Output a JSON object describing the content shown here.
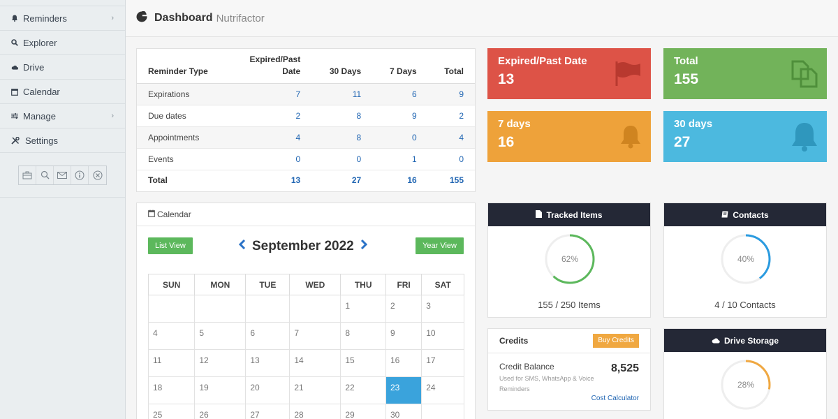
{
  "sidebar": {
    "items": [
      {
        "label": "Reminders",
        "icon": "bell-icon",
        "chevron": "›"
      },
      {
        "label": "Explorer",
        "icon": "search-icon"
      },
      {
        "label": "Drive",
        "icon": "cloud-icon"
      },
      {
        "label": "Calendar",
        "icon": "calendar-icon"
      },
      {
        "label": "Manage",
        "icon": "sliders-icon",
        "chevron": "›"
      },
      {
        "label": "Settings",
        "icon": "tools-icon"
      }
    ],
    "tools": [
      "briefcase-icon",
      "search-icon",
      "mail-icon",
      "info-icon",
      "close-circle-icon"
    ]
  },
  "header": {
    "title": "Dashboard",
    "subtitle": "Nutrifactor",
    "icon": "pie-chart-icon"
  },
  "reminder_table": {
    "headers": {
      "type": "Reminder Type",
      "expired_line1": "Expired/Past",
      "expired_line2": "Date",
      "d30": "30 Days",
      "d7": "7 Days",
      "total": "Total"
    },
    "rows": [
      {
        "type": "Expirations",
        "expired": "7",
        "d30": "11",
        "d7": "6",
        "total": "9"
      },
      {
        "type": "Due dates",
        "expired": "2",
        "d30": "8",
        "d7": "9",
        "total": "2"
      },
      {
        "type": "Appointments",
        "expired": "4",
        "d30": "8",
        "d7": "0",
        "total": "4"
      },
      {
        "type": "Events",
        "expired": "0",
        "d30": "0",
        "d7": "1",
        "total": "0"
      },
      {
        "type": "Total",
        "expired": "13",
        "d30": "27",
        "d7": "16",
        "total": "155"
      }
    ]
  },
  "cards": [
    {
      "label": "Expired/Past Date",
      "value": "13",
      "color": "#dd5347",
      "icon": "flag-icon"
    },
    {
      "label": "Total",
      "value": "155",
      "color": "#72b35a",
      "icon": "copy-icon"
    },
    {
      "label": "7 days",
      "value": "16",
      "color": "#eea23a",
      "icon": "bell-icon"
    },
    {
      "label": "30 days",
      "value": "27",
      "color": "#4cb9df",
      "icon": "bell-icon"
    }
  ],
  "calendar": {
    "heading": "Calendar",
    "list_view": "List View",
    "year_view": "Year View",
    "month": "September 2022",
    "days": [
      "SUN",
      "MON",
      "TUE",
      "WED",
      "THU",
      "FRI",
      "SAT"
    ],
    "weeks": [
      [
        "",
        "",
        "",
        "",
        "1",
        "2",
        "3"
      ],
      [
        "4",
        "5",
        "6",
        "7",
        "8",
        "9",
        "10"
      ],
      [
        "11",
        "12",
        "13",
        "14",
        "15",
        "16",
        "17"
      ],
      [
        "18",
        "19",
        "20",
        "21",
        "22",
        "23",
        "24"
      ],
      [
        "25",
        "26",
        "27",
        "28",
        "29",
        "30",
        ""
      ]
    ],
    "today": "23"
  },
  "tracked": {
    "title": "Tracked Items",
    "percent_label": "62%",
    "percent": 0.62,
    "caption": "155 / 250 Items",
    "ring_color": "#5cb85c"
  },
  "contacts": {
    "title": "Contacts",
    "percent_label": "40%",
    "percent": 0.4,
    "caption": "4 / 10 Contacts",
    "ring_color": "#2a9be0"
  },
  "credits": {
    "title": "Credits",
    "buy": "Buy Credits",
    "balance_label": "Credit Balance",
    "description": "Used for SMS, WhatsApp & Voice Reminders",
    "balance": "8,525",
    "calculator": "Cost Calculator"
  },
  "drive": {
    "title": "Drive Storage",
    "percent_label": "28%",
    "percent": 0.28,
    "ring_color": "#f0a841"
  }
}
